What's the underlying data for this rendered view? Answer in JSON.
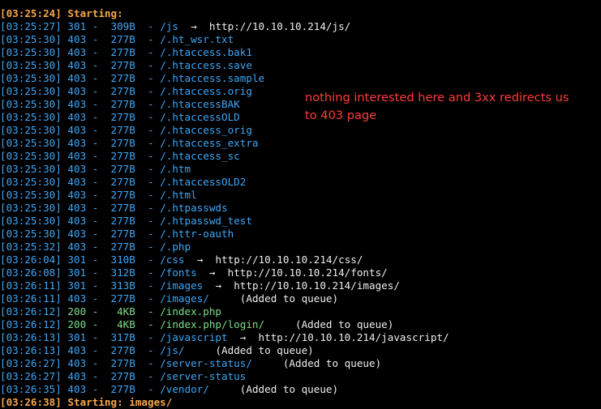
{
  "colors": {
    "background": "#000000",
    "timestamp": "#3ea6f5",
    "status_300": "#3ea6f5",
    "status_400": "#3ea6f5",
    "status_200": "#7fdd8a",
    "heading": "#f7a64a",
    "annotation": "#ff3b3b",
    "plain": "#ededed"
  },
  "header": {
    "timestamp": "[03:25:24]",
    "text": "Starting:"
  },
  "rows": [
    {
      "timestamp": "[03:25:27]",
      "code": "301",
      "size": "309B",
      "path": "/js",
      "arrow": "→",
      "redirect": "http://10.10.10.214/js/",
      "note": "",
      "color": "blue"
    },
    {
      "timestamp": "[03:25:30]",
      "code": "403",
      "size": "277B",
      "path": "/.ht_wsr.txt",
      "arrow": "",
      "redirect": "",
      "note": "",
      "color": "blue"
    },
    {
      "timestamp": "[03:25:30]",
      "code": "403",
      "size": "277B",
      "path": "/.htaccess.bak1",
      "arrow": "",
      "redirect": "",
      "note": "",
      "color": "blue"
    },
    {
      "timestamp": "[03:25:30]",
      "code": "403",
      "size": "277B",
      "path": "/.htaccess.save",
      "arrow": "",
      "redirect": "",
      "note": "",
      "color": "blue"
    },
    {
      "timestamp": "[03:25:30]",
      "code": "403",
      "size": "277B",
      "path": "/.htaccess.sample",
      "arrow": "",
      "redirect": "",
      "note": "",
      "color": "blue"
    },
    {
      "timestamp": "[03:25:30]",
      "code": "403",
      "size": "277B",
      "path": "/.htaccess.orig",
      "arrow": "",
      "redirect": "",
      "note": "",
      "color": "blue"
    },
    {
      "timestamp": "[03:25:30]",
      "code": "403",
      "size": "277B",
      "path": "/.htaccessBAK",
      "arrow": "",
      "redirect": "",
      "note": "",
      "color": "blue"
    },
    {
      "timestamp": "[03:25:30]",
      "code": "403",
      "size": "277B",
      "path": "/.htaccessOLD",
      "arrow": "",
      "redirect": "",
      "note": "",
      "color": "blue"
    },
    {
      "timestamp": "[03:25:30]",
      "code": "403",
      "size": "277B",
      "path": "/.htaccess_orig",
      "arrow": "",
      "redirect": "",
      "note": "",
      "color": "blue"
    },
    {
      "timestamp": "[03:25:30]",
      "code": "403",
      "size": "277B",
      "path": "/.htaccess_extra",
      "arrow": "",
      "redirect": "",
      "note": "",
      "color": "blue"
    },
    {
      "timestamp": "[03:25:30]",
      "code": "403",
      "size": "277B",
      "path": "/.htaccess_sc",
      "arrow": "",
      "redirect": "",
      "note": "",
      "color": "blue"
    },
    {
      "timestamp": "[03:25:30]",
      "code": "403",
      "size": "277B",
      "path": "/.htm",
      "arrow": "",
      "redirect": "",
      "note": "",
      "color": "blue"
    },
    {
      "timestamp": "[03:25:30]",
      "code": "403",
      "size": "277B",
      "path": "/.htaccessOLD2",
      "arrow": "",
      "redirect": "",
      "note": "",
      "color": "blue"
    },
    {
      "timestamp": "[03:25:30]",
      "code": "403",
      "size": "277B",
      "path": "/.html",
      "arrow": "",
      "redirect": "",
      "note": "",
      "color": "blue"
    },
    {
      "timestamp": "[03:25:30]",
      "code": "403",
      "size": "277B",
      "path": "/.htpasswds",
      "arrow": "",
      "redirect": "",
      "note": "",
      "color": "blue"
    },
    {
      "timestamp": "[03:25:30]",
      "code": "403",
      "size": "277B",
      "path": "/.htpasswd_test",
      "arrow": "",
      "redirect": "",
      "note": "",
      "color": "blue"
    },
    {
      "timestamp": "[03:25:30]",
      "code": "403",
      "size": "277B",
      "path": "/.httr-oauth",
      "arrow": "",
      "redirect": "",
      "note": "",
      "color": "blue"
    },
    {
      "timestamp": "[03:25:32]",
      "code": "403",
      "size": "277B",
      "path": "/.php",
      "arrow": "",
      "redirect": "",
      "note": "",
      "color": "blue"
    },
    {
      "timestamp": "[03:26:04]",
      "code": "301",
      "size": "310B",
      "path": "/css",
      "arrow": "→",
      "redirect": "http://10.10.10.214/css/",
      "note": "",
      "color": "blue"
    },
    {
      "timestamp": "[03:26:08]",
      "code": "301",
      "size": "312B",
      "path": "/fonts",
      "arrow": "→",
      "redirect": "http://10.10.10.214/fonts/",
      "note": "",
      "color": "blue"
    },
    {
      "timestamp": "[03:26:11]",
      "code": "301",
      "size": "313B",
      "path": "/images",
      "arrow": "→",
      "redirect": "http://10.10.10.214/images/",
      "note": "",
      "color": "blue"
    },
    {
      "timestamp": "[03:26:11]",
      "code": "403",
      "size": "277B",
      "path": "/images/",
      "arrow": "",
      "redirect": "",
      "note": "(Added to queue)",
      "color": "blue"
    },
    {
      "timestamp": "[03:26:12]",
      "code": "200",
      "size": "4KB",
      "path": "/index.php",
      "arrow": "",
      "redirect": "",
      "note": "",
      "color": "green"
    },
    {
      "timestamp": "[03:26:12]",
      "code": "200",
      "size": "4KB",
      "path": "/index.php/login/",
      "arrow": "",
      "redirect": "",
      "note": "(Added to queue)",
      "color": "green"
    },
    {
      "timestamp": "[03:26:13]",
      "code": "301",
      "size": "317B",
      "path": "/javascript",
      "arrow": "→",
      "redirect": "http://10.10.10.214/javascript/",
      "note": "",
      "color": "blue"
    },
    {
      "timestamp": "[03:26:13]",
      "code": "403",
      "size": "277B",
      "path": "/js/",
      "arrow": "",
      "redirect": "",
      "note": "(Added to queue)",
      "color": "blue"
    },
    {
      "timestamp": "[03:26:27]",
      "code": "403",
      "size": "277B",
      "path": "/server-status/",
      "arrow": "",
      "redirect": "",
      "note": "(Added to queue)",
      "color": "blue"
    },
    {
      "timestamp": "[03:26:27]",
      "code": "403",
      "size": "277B",
      "path": "/server-status",
      "arrow": "",
      "redirect": "",
      "note": "",
      "color": "blue"
    },
    {
      "timestamp": "[03:26:35]",
      "code": "403",
      "size": "277B",
      "path": "/vendor/",
      "arrow": "",
      "redirect": "",
      "note": "(Added to queue)",
      "color": "blue"
    }
  ],
  "footer": {
    "timestamp": "[03:26:38]",
    "text": "Starting: images/"
  },
  "annotation": {
    "line1": "nothing interested here and 3xx redirects us",
    "line2": "to 403 page"
  }
}
